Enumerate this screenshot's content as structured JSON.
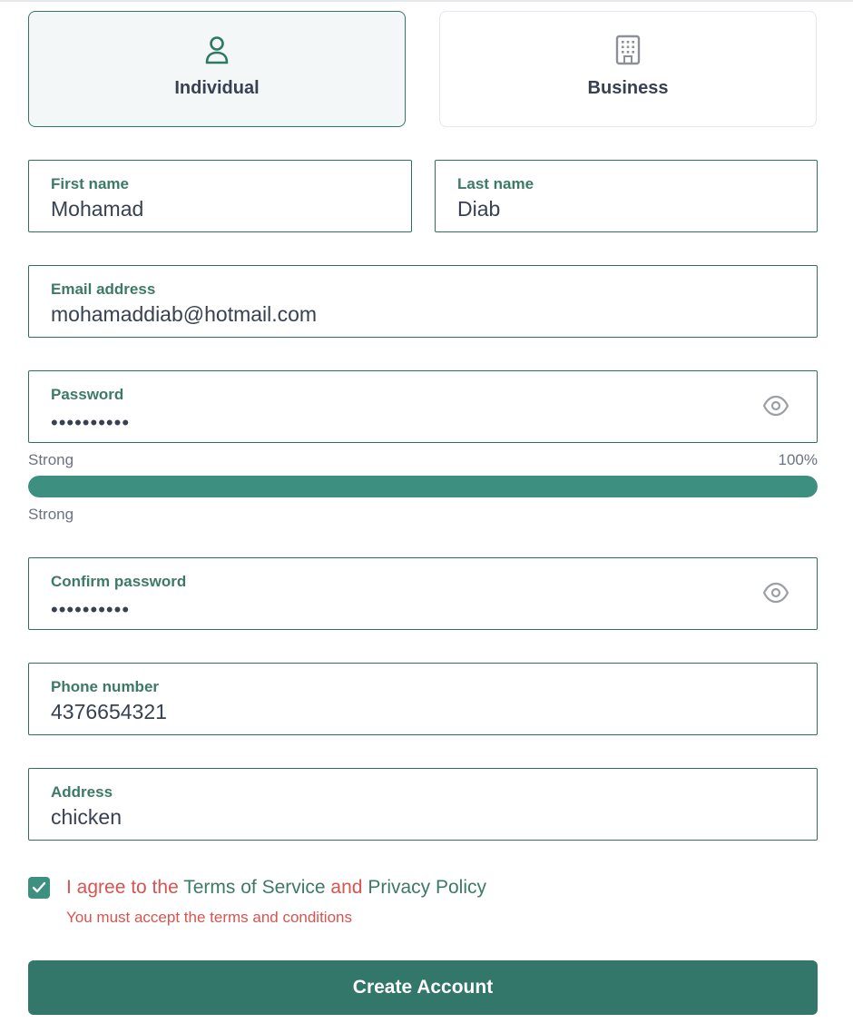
{
  "account_type": {
    "individual_label": "Individual",
    "business_label": "Business",
    "selected": "Individual"
  },
  "fields": {
    "first_name": {
      "label": "First name",
      "value": "Mohamad"
    },
    "last_name": {
      "label": "Last name",
      "value": "Diab"
    },
    "email": {
      "label": "Email address",
      "value": "mohamaddiab@hotmail.com"
    },
    "password": {
      "label": "Password",
      "masked_value": "••••••••••"
    },
    "confirm_password": {
      "label": "Confirm password",
      "masked_value": "••••••••••"
    },
    "phone": {
      "label": "Phone number",
      "value": "4376654321"
    },
    "address": {
      "label": "Address",
      "value": "chicken"
    }
  },
  "password_strength": {
    "label_top": "Strong",
    "percent_label": "100%",
    "percent": 100,
    "label_bottom": "Strong"
  },
  "terms": {
    "checked": true,
    "prefix": "I agree to the ",
    "terms_link": "Terms of Service",
    "conjunction": " and ",
    "privacy_link": "Privacy Policy",
    "error": "You must accept the terms and conditions"
  },
  "submit_label": "Create Account",
  "colors": {
    "accent": "#3d9080",
    "primary_button": "#33776a",
    "error": "#d9534f",
    "field_border": "#2f6f5e"
  }
}
